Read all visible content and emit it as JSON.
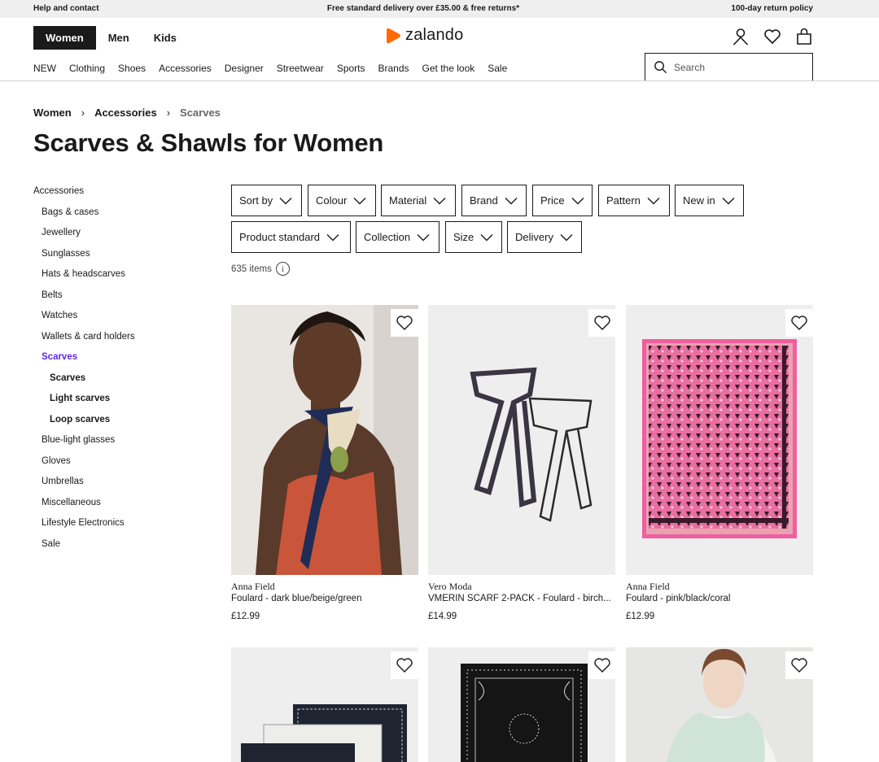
{
  "topbar": {
    "help": "Help and contact",
    "delivery": "Free standard delivery over £35.00 & free returns*",
    "returns": "100-day return policy"
  },
  "header": {
    "genders": [
      "Women",
      "Men",
      "Kids"
    ],
    "active_gender": "Women",
    "logo_text": "zalando",
    "icons": [
      "user-icon",
      "heart-icon",
      "bag-icon"
    ],
    "nav": [
      "NEW",
      "Clothing",
      "Shoes",
      "Accessories",
      "Designer",
      "Streetwear",
      "Sports",
      "Brands",
      "Get the look",
      "Sale"
    ],
    "search_placeholder": "Search"
  },
  "breadcrumb": [
    "Women",
    "Accessories",
    "Scarves"
  ],
  "page_title": "Scarves & Shawls for Women",
  "sidebar": {
    "heading": "Accessories",
    "items": [
      "Bags & cases",
      "Jewellery",
      "Sunglasses",
      "Hats & headscarves",
      "Belts",
      "Watches",
      "Wallets & card holders",
      "Scarves",
      "Scarves",
      "Light scarves",
      "Loop scarves",
      "Blue-light glasses",
      "Gloves",
      "Umbrellas",
      "Miscellaneous",
      "Lifestyle Electronics",
      "Sale"
    ]
  },
  "filters": {
    "row1": [
      "Sort by",
      "Colour",
      "Material",
      "Brand",
      "Price",
      "Pattern",
      "New in"
    ],
    "row2": [
      "Product standard",
      "Collection",
      "Size",
      "Delivery"
    ]
  },
  "item_count": "635 items",
  "products": [
    {
      "brand": "Anna Field",
      "name": "Foulard - dark blue/beige/green",
      "price": "£12.99"
    },
    {
      "brand": "Vero Moda",
      "name": "VMERIN SCARF 2-PACK - Foulard - birch...",
      "price": "£14.99"
    },
    {
      "brand": "Anna Field",
      "name": "Foulard - pink/black/coral",
      "price": "£12.99"
    },
    {
      "brand": "",
      "name": "",
      "price": ""
    },
    {
      "brand": "",
      "name": "",
      "price": ""
    },
    {
      "brand": "",
      "name": "",
      "price": ""
    }
  ],
  "colors": {
    "accent_purple": "#6328e0",
    "logo_orange": "#ff6900",
    "text": "#1a1a1a"
  }
}
